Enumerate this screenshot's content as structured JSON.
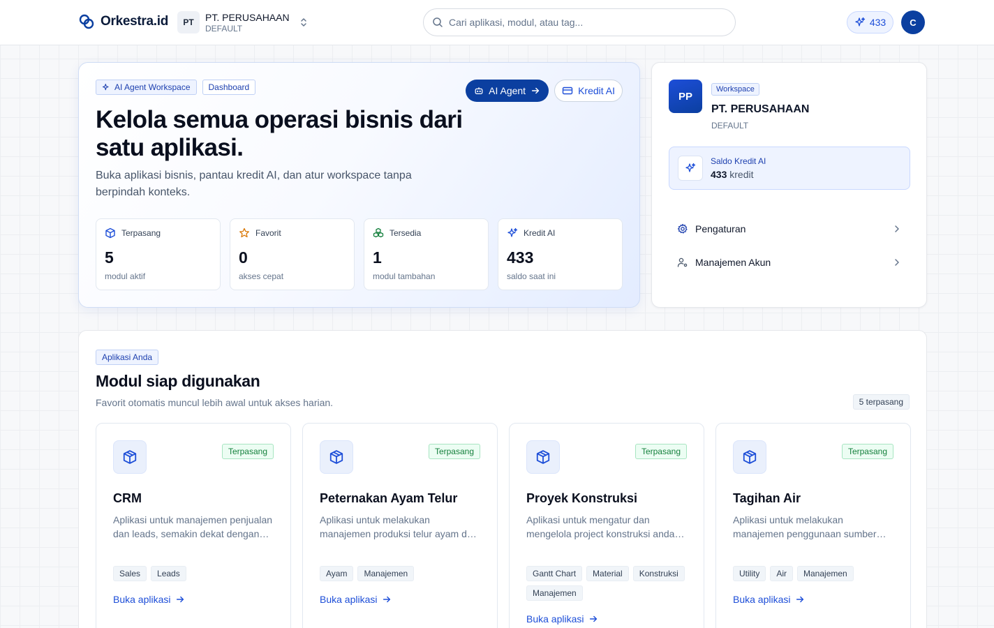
{
  "brand": {
    "name": "Orkestra.id"
  },
  "org": {
    "initials": "PT",
    "name": "PT. PERUSAHAAN",
    "plan": "DEFAULT"
  },
  "search": {
    "placeholder": "Cari aplikasi, modul, atau tag..."
  },
  "credits": {
    "count": "433"
  },
  "user": {
    "initial": "C"
  },
  "hero": {
    "tags": [
      "AI Agent Workspace",
      "Dashboard"
    ],
    "ai_agent_label": "AI Agent",
    "kredit_label": "Kredit AI",
    "title": "Kelola semua operasi bisnis dari satu aplikasi.",
    "subtitle": "Buka aplikasi bisnis, pantau kredit AI, dan atur workspace tanpa berpindah konteks.",
    "stats": [
      {
        "label": "Terpasang",
        "value": "5",
        "caption": "modul aktif",
        "icon": "box-icon"
      },
      {
        "label": "Favorit",
        "value": "0",
        "caption": "akses cepat",
        "icon": "star-icon"
      },
      {
        "label": "Tersedia",
        "value": "1",
        "caption": "modul tambahan",
        "icon": "boxes-icon"
      },
      {
        "label": "Kredit AI",
        "value": "433",
        "caption": "saldo saat ini",
        "icon": "sparkles-icon"
      }
    ]
  },
  "workspace": {
    "initials": "PP",
    "tag": "Workspace",
    "name": "PT. PERUSAHAAN",
    "plan": "DEFAULT",
    "credit_label": "Saldo Kredit AI",
    "credit_value": "433",
    "credit_unit": "kredit",
    "menu": [
      {
        "label": "Pengaturan",
        "icon": "gear-icon"
      },
      {
        "label": "Manajemen Akun",
        "icon": "user-cog-icon"
      }
    ]
  },
  "apps": {
    "tag": "Aplikasi Anda",
    "title": "Modul siap digunakan",
    "subtitle": "Favorit otomatis muncul lebih awal untuk akses harian.",
    "count": "5 terpasang",
    "cards": [
      {
        "title": "CRM",
        "status": "Terpasang",
        "description": "Aplikasi untuk manajemen penjualan dan leads, semakin dekat dengan pelanggan",
        "tags": [
          "Sales",
          "Leads"
        ],
        "link": "Buka aplikasi"
      },
      {
        "title": "Peternakan Ayam Telur",
        "status": "Terpasang",
        "description": "Aplikasi untuk melakukan manajemen produksi telur ayam dan kesehatan ternak",
        "tags": [
          "Ayam",
          "Manajemen"
        ],
        "link": "Buka aplikasi"
      },
      {
        "title": "Proyek Konstruksi",
        "status": "Terpasang",
        "description": "Aplikasi untuk mengatur dan mengelola project konstruksi anda secara terpadu",
        "tags": [
          "Gantt Chart",
          "Material",
          "Konstruksi",
          "Manajemen"
        ],
        "link": "Buka aplikasi"
      },
      {
        "title": "Tagihan Air",
        "status": "Terpasang",
        "description": "Aplikasi untuk melakukan manajemen penggunaan sumber daya air pelanggan",
        "tags": [
          "Utility",
          "Air",
          "Manajemen"
        ],
        "link": "Buka aplikasi"
      }
    ]
  },
  "colors": {
    "primary": "#0b3fa0",
    "accent": "#1d4ed8",
    "success": "#15803d"
  }
}
